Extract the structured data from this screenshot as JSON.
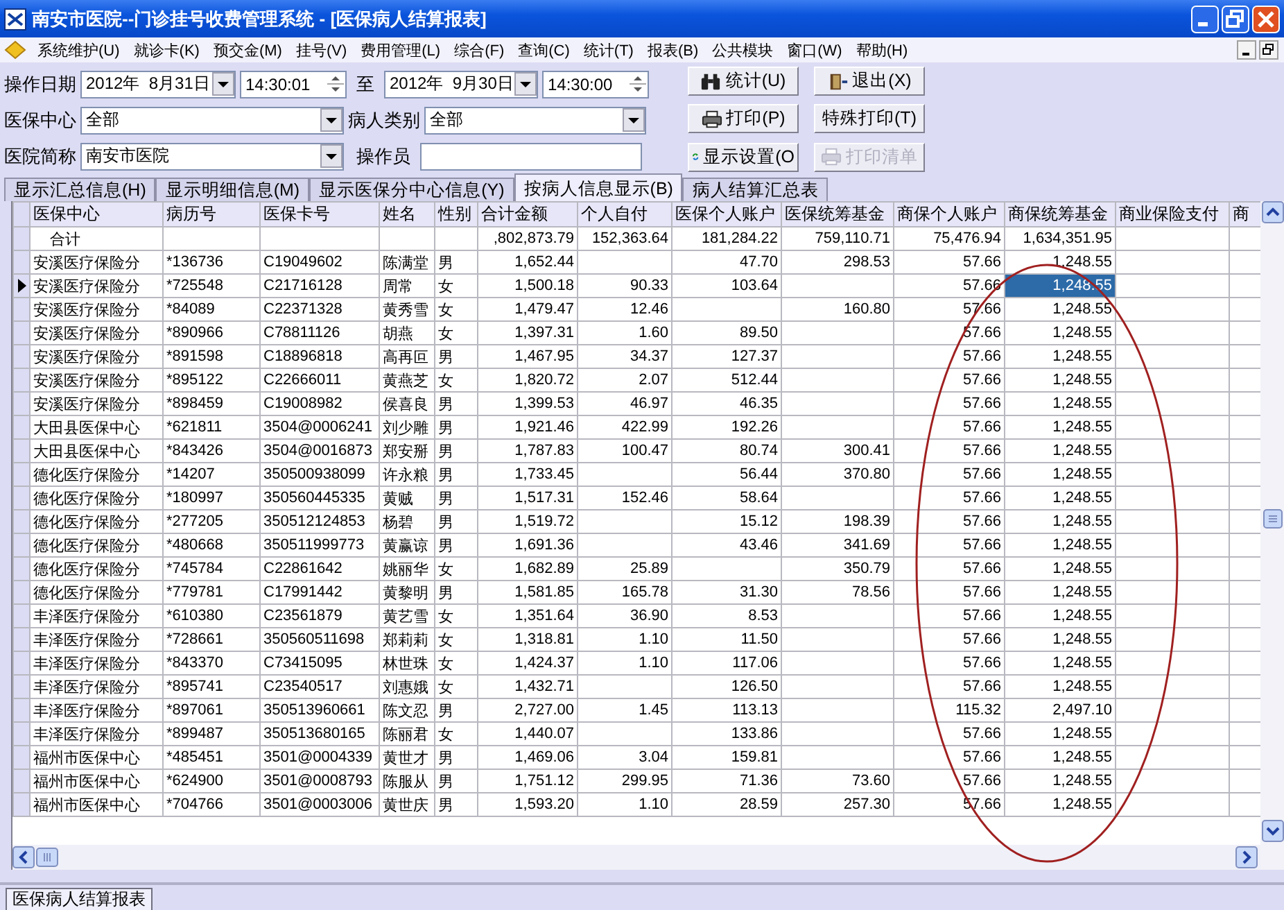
{
  "window": {
    "title": "南安市医院--门诊挂号收费管理系统 - [医保病人结算报表]"
  },
  "menu": {
    "items": [
      "系统维护(U)",
      "就诊卡(K)",
      "预交金(M)",
      "挂号(V)",
      "费用管理(L)",
      "综合(F)",
      "查询(C)",
      "统计(T)",
      "报表(B)",
      "公共模块",
      "窗口(W)",
      "帮助(H)"
    ]
  },
  "filters": {
    "date_label": "操作日期",
    "start_date": "2012年  8月31日",
    "start_time": "14:30:01",
    "to_label": "至",
    "end_date": "2012年  9月30日",
    "end_time": "14:30:00",
    "center_label": "医保中心",
    "center_value": "全部",
    "patient_type_label": "病人类别",
    "patient_type_value": "全部",
    "hospital_label": "医院简称",
    "hospital_value": "南安市医院",
    "operator_label": "操作员"
  },
  "buttons": [
    {
      "label": "统计(U)",
      "kind": "binoculars",
      "disabled": false
    },
    {
      "label": "退出(X)",
      "kind": "exit",
      "disabled": false
    },
    {
      "label": "打印(P)",
      "kind": "printer",
      "disabled": false
    },
    {
      "label": "特殊打印(T)",
      "kind": "plain",
      "disabled": false
    },
    {
      "label": "显示设置(O",
      "kind": "refresh",
      "disabled": false
    },
    {
      "label": "打印清单",
      "kind": "printer",
      "disabled": true
    }
  ],
  "tabs": [
    {
      "label": "显示汇总信息(H)",
      "selected": false
    },
    {
      "label": "显示明细信息(M)",
      "selected": false
    },
    {
      "label": "显示医保分中心信息(Y)",
      "selected": false
    },
    {
      "label": "按病人信息显示(B)",
      "selected": true
    },
    {
      "label": "病人结算汇总表",
      "selected": false
    }
  ],
  "table": {
    "columns": [
      {
        "label": "医保中心"
      },
      {
        "label": "病历号"
      },
      {
        "label": "医保卡号"
      },
      {
        "label": "姓名"
      },
      {
        "label": "性别"
      },
      {
        "label": "合计金额"
      },
      {
        "label": "个人自付"
      },
      {
        "label": "医保个人账户"
      },
      {
        "label": "医保统筹基金"
      },
      {
        "label": "商保个人账户"
      },
      {
        "label": "商保统筹基金"
      },
      {
        "label": "商业保险支付"
      },
      {
        "label": "商"
      }
    ],
    "total_row": {
      "label": "合计",
      "amounts": [
        ",802,873.79",
        "152,363.64",
        "181,284.22",
        "759,110.71",
        "75,476.94",
        "1,634,351.95"
      ]
    },
    "rows": [
      {
        "selected": false,
        "cells": [
          "安溪医疗保险分",
          "*136736",
          "C19049602",
          "陈满堂",
          "男",
          "1,652.44",
          null,
          "47.70",
          "298.53",
          "57.66",
          "1,248.55"
        ]
      },
      {
        "selected": true,
        "cells": [
          {
            "text": "安溪医疗保险分",
            "selected": false
          },
          {
            "text": "*725548",
            "selected": false
          },
          {
            "text": "C21716128",
            "selected": false
          },
          {
            "text": "周常",
            "selected": false
          },
          {
            "text": "女",
            "selected": false
          },
          {
            "text": "1,500.18",
            "selected": false
          },
          {
            "text": "90.33",
            "selected": false
          },
          {
            "text": "103.64",
            "selected": false
          },
          {
            "text": null,
            "selected": false
          },
          {
            "text": "57.66",
            "selected": false
          },
          {
            "text": "1,248.55",
            "selected": true
          }
        ]
      },
      {
        "selected": false,
        "cells": [
          "安溪医疗保险分",
          "*84089",
          "C22371328",
          "黄秀雪",
          "女",
          "1,479.47",
          "12.46",
          null,
          "160.80",
          "57.66",
          "1,248.55"
        ]
      },
      {
        "selected": false,
        "cells": [
          "安溪医疗保险分",
          "*890966",
          "C78811126",
          "胡燕",
          "女",
          "1,397.31",
          "1.60",
          "89.50",
          null,
          "57.66",
          "1,248.55"
        ]
      },
      {
        "selected": false,
        "cells": [
          "安溪医疗保险分",
          "*891598",
          "C18896818",
          "高再叵",
          "男",
          "1,467.95",
          "34.37",
          "127.37",
          null,
          "57.66",
          "1,248.55"
        ]
      },
      {
        "selected": false,
        "cells": [
          "安溪医疗保险分",
          "*895122",
          "C22666011",
          "黄燕芝",
          "女",
          "1,820.72",
          "2.07",
          "512.44",
          null,
          "57.66",
          "1,248.55"
        ]
      },
      {
        "selected": false,
        "cells": [
          "安溪医疗保险分",
          "*898459",
          "C19008982",
          "侯喜良",
          "男",
          "1,399.53",
          "46.97",
          "46.35",
          null,
          "57.66",
          "1,248.55"
        ]
      },
      {
        "selected": false,
        "cells": [
          "大田县医保中心",
          "*621811",
          "3504@0006241",
          "刘少雕",
          "男",
          "1,921.46",
          "422.99",
          "192.26",
          null,
          "57.66",
          "1,248.55"
        ]
      },
      {
        "selected": false,
        "cells": [
          "大田县医保中心",
          "*843426",
          "3504@0016873",
          "郑安掰",
          "男",
          "1,787.83",
          "100.47",
          "80.74",
          "300.41",
          "57.66",
          "1,248.55"
        ]
      },
      {
        "selected": false,
        "cells": [
          "德化医疗保险分",
          "*14207",
          "350500938099",
          "许永粮",
          "男",
          "1,733.45",
          null,
          "56.44",
          "370.80",
          "57.66",
          "1,248.55"
        ]
      },
      {
        "selected": false,
        "cells": [
          "德化医疗保险分",
          "*180997",
          "350560445335",
          "黄贼",
          "男",
          "1,517.31",
          "152.46",
          "58.64",
          null,
          "57.66",
          "1,248.55"
        ]
      },
      {
        "selected": false,
        "cells": [
          "德化医疗保险分",
          "*277205",
          "350512124853",
          "杨碧",
          "男",
          "1,519.72",
          null,
          "15.12",
          "198.39",
          "57.66",
          "1,248.55"
        ]
      },
      {
        "selected": false,
        "cells": [
          "德化医疗保险分",
          "*480668",
          "350511999773",
          "黄赢谅",
          "男",
          "1,691.36",
          null,
          "43.46",
          "341.69",
          "57.66",
          "1,248.55"
        ]
      },
      {
        "selected": false,
        "cells": [
          "德化医疗保险分",
          "*745784",
          "C22861642",
          "姚丽华",
          "女",
          "1,682.89",
          "25.89",
          null,
          "350.79",
          "57.66",
          "1,248.55"
        ]
      },
      {
        "selected": false,
        "cells": [
          "德化医疗保险分",
          "*779781",
          "C17991442",
          "黄黎明",
          "男",
          "1,581.85",
          "165.78",
          "31.30",
          "78.56",
          "57.66",
          "1,248.55"
        ]
      },
      {
        "selected": false,
        "cells": [
          "丰泽医疗保险分",
          "*610380",
          "C23561879",
          "黄艺雪",
          "女",
          "1,351.64",
          "36.90",
          "8.53",
          null,
          "57.66",
          "1,248.55"
        ]
      },
      {
        "selected": false,
        "cells": [
          "丰泽医疗保险分",
          "*728661",
          "350560511698",
          "郑莉莉",
          "女",
          "1,318.81",
          "1.10",
          "11.50",
          null,
          "57.66",
          "1,248.55"
        ]
      },
      {
        "selected": false,
        "cells": [
          "丰泽医疗保险分",
          "*843370",
          "C73415095",
          "林世珠",
          "女",
          "1,424.37",
          "1.10",
          "117.06",
          null,
          "57.66",
          "1,248.55"
        ]
      },
      {
        "selected": false,
        "cells": [
          "丰泽医疗保险分",
          "*895741",
          "C23540517",
          "刘惠娥",
          "女",
          "1,432.71",
          null,
          "126.50",
          null,
          "57.66",
          "1,248.55"
        ]
      },
      {
        "selected": false,
        "cells": [
          "丰泽医疗保险分",
          "*897061",
          "350513960661",
          "陈文忍",
          "男",
          "2,727.00",
          "1.45",
          "113.13",
          null,
          "115.32",
          "2,497.10"
        ]
      },
      {
        "selected": false,
        "cells": [
          "丰泽医疗保险分",
          "*899487",
          "350513680165",
          "陈丽君",
          "女",
          "1,440.07",
          null,
          "133.86",
          null,
          "57.66",
          "1,248.55"
        ]
      },
      {
        "selected": false,
        "cells": [
          "福州市医保中心",
          "*485451",
          "3501@0004339",
          "黄世才",
          "男",
          "1,469.06",
          "3.04",
          "159.81",
          null,
          "57.66",
          "1,248.55"
        ]
      },
      {
        "selected": false,
        "cells": [
          "福州市医保中心",
          "*624900",
          "3501@0008793",
          "陈服从",
          "男",
          "1,751.12",
          "299.95",
          "71.36",
          "73.60",
          "57.66",
          "1,248.55"
        ]
      },
      {
        "selected": false,
        "cells": [
          "福州市医保中心",
          "*704766",
          "3501@0003006",
          "黄世庆",
          "男",
          "1,593.20",
          "1.10",
          "28.59",
          "257.30",
          "57.66",
          "1,248.55"
        ]
      }
    ]
  },
  "status_bar": {
    "tabs": [
      {
        "label": "医保病人结算报表",
        "selected": true
      }
    ]
  }
}
